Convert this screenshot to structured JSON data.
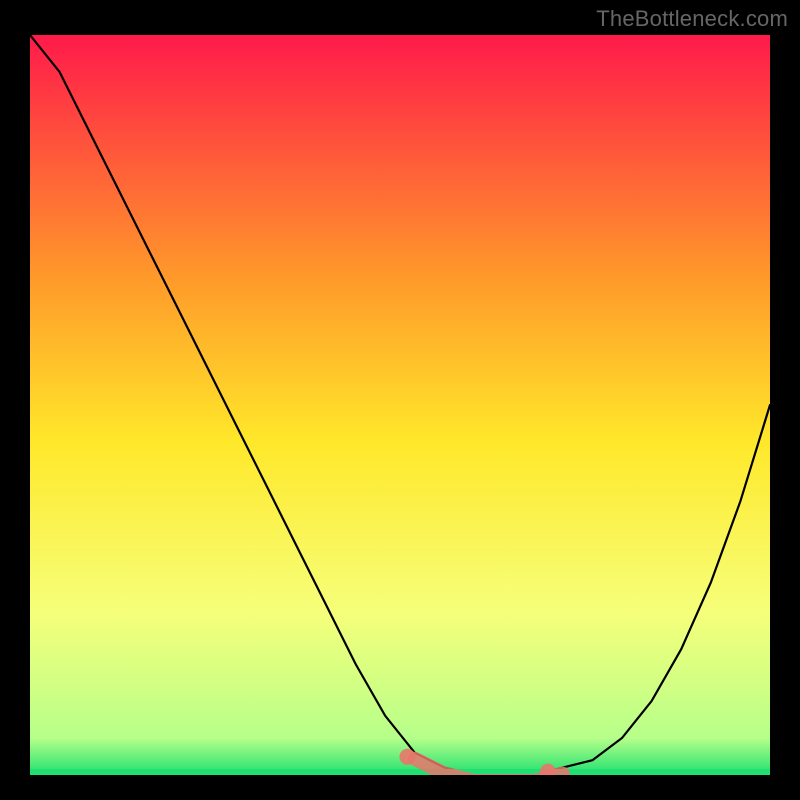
{
  "watermark": "TheBottleneck.com",
  "colors": {
    "page_bg": "#000000",
    "gradient_top": "#ff1a4a",
    "gradient_mid1": "#ff7a2a",
    "gradient_mid2": "#ffe82a",
    "gradient_mid3": "#f6ff7a",
    "gradient_bottom": "#20e070",
    "curve": "#000000",
    "highlight": "#e9756c"
  },
  "chart_data": {
    "type": "line",
    "title": "",
    "xlabel": "",
    "ylabel": "",
    "x": [
      0.0,
      0.04,
      0.08,
      0.12,
      0.16,
      0.2,
      0.24,
      0.28,
      0.32,
      0.36,
      0.4,
      0.44,
      0.48,
      0.52,
      0.56,
      0.6,
      0.64,
      0.68,
      0.72,
      0.76,
      0.8,
      0.84,
      0.88,
      0.92,
      0.96,
      1.0
    ],
    "values": [
      1.0,
      0.95,
      0.87,
      0.79,
      0.71,
      0.63,
      0.55,
      0.47,
      0.39,
      0.31,
      0.23,
      0.15,
      0.08,
      0.03,
      0.01,
      0.0,
      0.0,
      0.0,
      0.01,
      0.02,
      0.05,
      0.1,
      0.17,
      0.26,
      0.37,
      0.5
    ],
    "xlim": [
      0,
      1
    ],
    "ylim": [
      0,
      1
    ],
    "gradient_stops": [
      {
        "pos": 0.0,
        "color": "#ff1a4a"
      },
      {
        "pos": 0.33,
        "color": "#ff9a2a"
      },
      {
        "pos": 0.55,
        "color": "#ffe82a"
      },
      {
        "pos": 0.78,
        "color": "#f6ff7a"
      },
      {
        "pos": 0.95,
        "color": "#b6ff8a"
      },
      {
        "pos": 1.0,
        "color": "#20e070"
      }
    ],
    "highlight_segments": [
      {
        "x0": 0.51,
        "x1": 0.7,
        "kind": "bottom-band"
      }
    ]
  }
}
